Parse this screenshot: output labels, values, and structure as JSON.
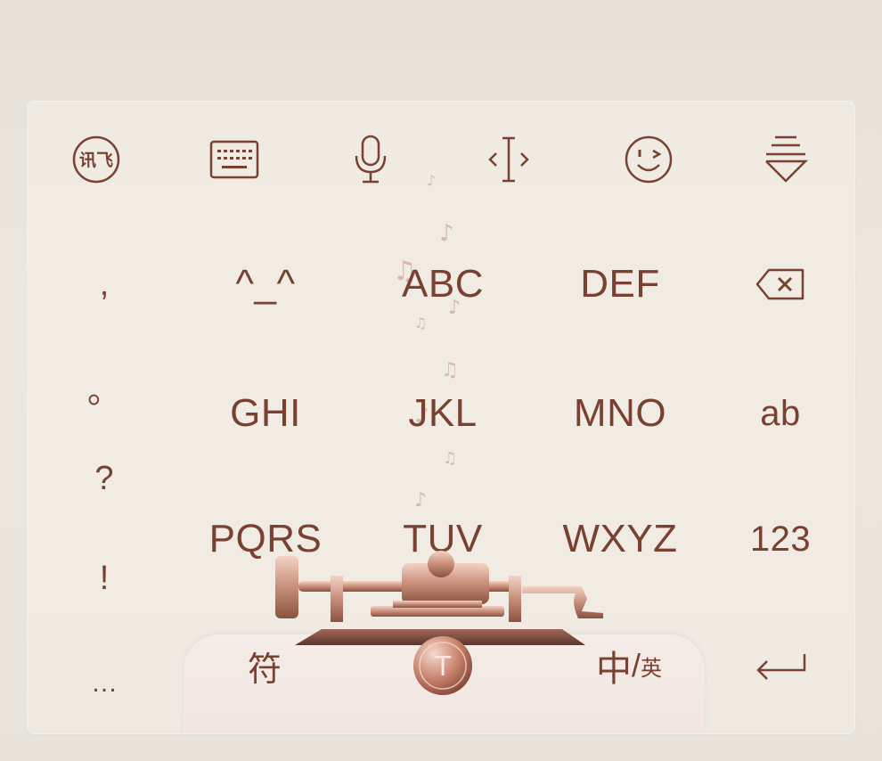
{
  "toolbar": {
    "logo_text": "讯飞",
    "items": [
      {
        "name": "ifly-logo-icon"
      },
      {
        "name": "keyboard-icon"
      },
      {
        "name": "microphone-icon"
      },
      {
        "name": "text-cursor-icon"
      },
      {
        "name": "emoji-wink-icon"
      },
      {
        "name": "hide-keyboard-icon"
      }
    ]
  },
  "punctuation": [
    ",",
    "。",
    "?",
    "!",
    "…"
  ],
  "keys": {
    "emoticon": "^_^",
    "abc": "ABC",
    "def": "DEF",
    "ghi": "GHI",
    "jkl": "JKL",
    "mno": "MNO",
    "ab": "ab",
    "pqrs": "PQRS",
    "tuv": "TUV",
    "wxyz": "WXYZ",
    "num": "123",
    "symbol": "符",
    "lang_cn": "中",
    "lang_slash": "/",
    "lang_en": "英",
    "theme_badge": "T"
  },
  "colors": {
    "ink": "#7a4130",
    "rose_gold": "#c88e7a",
    "panel": "#efebe2"
  }
}
